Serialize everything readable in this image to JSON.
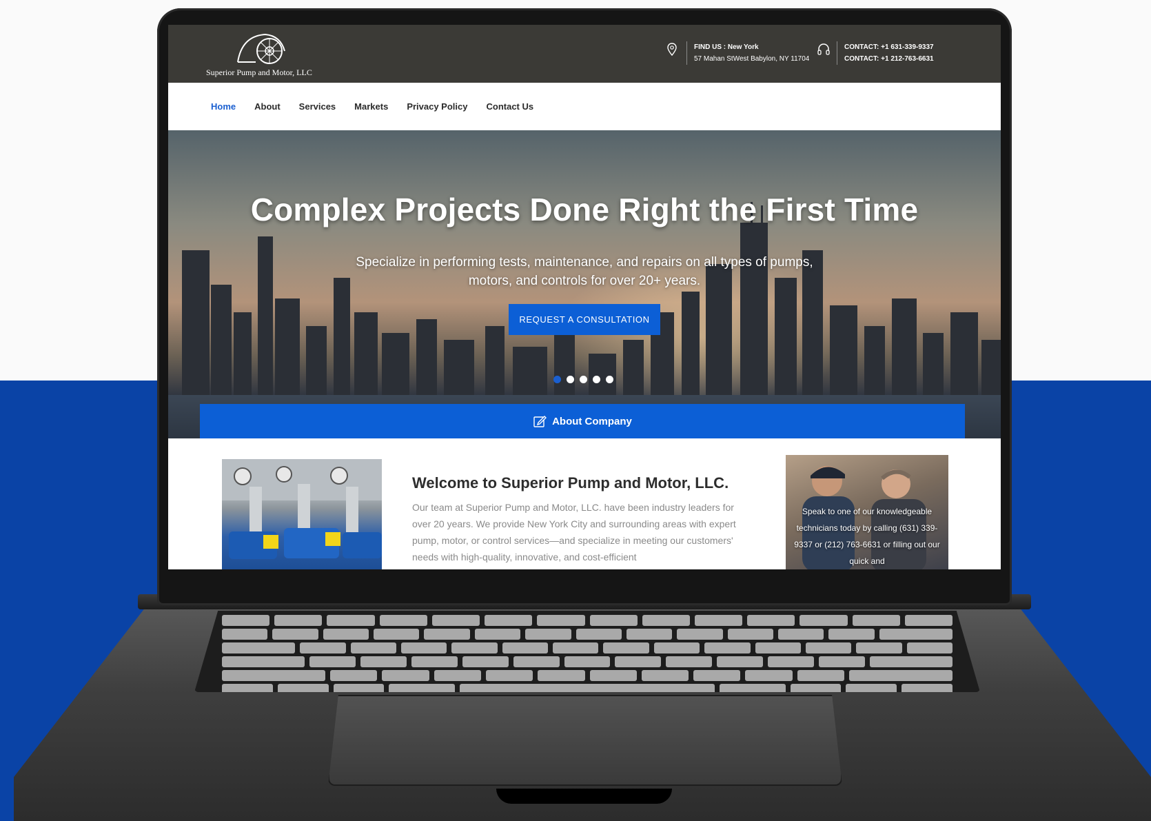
{
  "site": {
    "logo_text": "Superior Pump and Motor, LLC",
    "find_us_label": "FIND US : New York",
    "address": "57 Mahan StWest Babylon, NY 11704",
    "contact_1": "CONTACT: +1 631-339-9337",
    "contact_2": "CONTACT: +1 212-763-6631"
  },
  "nav": {
    "items": [
      {
        "label": "Home",
        "active": true
      },
      {
        "label": "About"
      },
      {
        "label": "Services"
      },
      {
        "label": "Markets"
      },
      {
        "label": "Privacy Policy"
      },
      {
        "label": "Contact Us"
      }
    ]
  },
  "hero": {
    "title": "Complex Projects Done Right the First Time",
    "subtitle": "Specialize in performing tests, maintenance, and repairs on all types of pumps, motors, and controls for over 20+ years.",
    "cta_label": "REQUEST A CONSULTATION",
    "slide_count": 5,
    "active_slide": 1
  },
  "about_bar": {
    "label": "About Company",
    "icon": "edit-icon"
  },
  "welcome": {
    "title": "Welcome to Superior Pump and Motor, LLC.",
    "body": "Our team at Superior Pump and Motor, LLC. have been industry leaders for over 20 years. We provide New York City and surrounding areas with expert pump, motor, or control services—and specialize in meeting our customers' needs with high-quality, innovative, and cost-efficient"
  },
  "callout": {
    "text": "Speak to one of our knowledgeable technicians today by calling (631) 339-9337 or (212) 763-6631 or filling out our quick and"
  },
  "colors": {
    "accent": "#0c5fd6",
    "topbar": "#3b3a36",
    "background_blue": "#0a43a6"
  }
}
